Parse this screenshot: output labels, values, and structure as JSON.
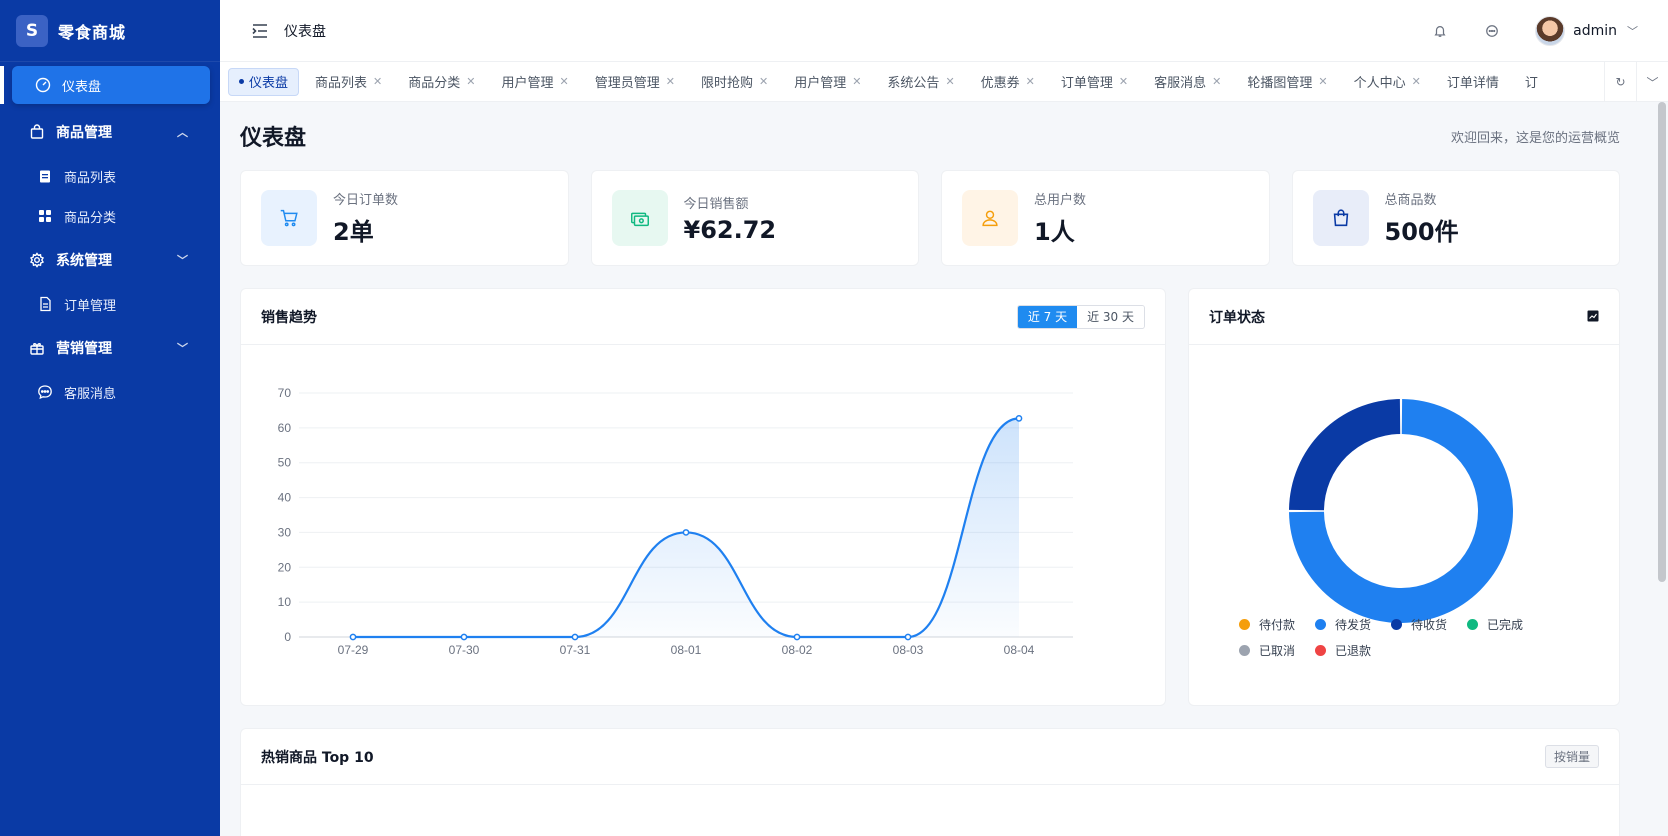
{
  "app": {
    "logo_letter": "S",
    "name": "零食商城"
  },
  "sidebar": {
    "items": [
      {
        "label": "仪表盘",
        "icon": "dashboard-icon",
        "type": "item",
        "active": true
      },
      {
        "label": "商品管理",
        "icon": "bag-icon",
        "type": "group",
        "expanded": true
      },
      {
        "label": "商品列表",
        "icon": "clipboard-icon",
        "type": "sub"
      },
      {
        "label": "商品分类",
        "icon": "grid-icon",
        "type": "sub"
      },
      {
        "label": "系统管理",
        "icon": "gear-icon",
        "type": "group",
        "expanded": false
      },
      {
        "label": "订单管理",
        "icon": "document-icon",
        "type": "sub"
      },
      {
        "label": "营销管理",
        "icon": "gift-icon",
        "type": "group",
        "expanded": false
      },
      {
        "label": "客服消息",
        "icon": "chat-icon",
        "type": "sub"
      }
    ]
  },
  "header": {
    "title": "仪表盘",
    "user": "admin"
  },
  "tabs": [
    "仪表盘",
    "商品列表",
    "商品分类",
    "用户管理",
    "管理员管理",
    "限时抢购",
    "用户管理",
    "系统公告",
    "优惠券",
    "订单管理",
    "客服消息",
    "轮播图管理",
    "个人中心",
    "订单详情",
    "订"
  ],
  "page": {
    "title": "仪表盘",
    "subtitle": "欢迎回来，这是您的运营概览"
  },
  "stats": [
    {
      "label": "今日订单数",
      "value": "2单",
      "icon": "cart-icon",
      "bg": "#e8f2fe",
      "color": "#1f8bf0"
    },
    {
      "label": "今日销售额",
      "value": "¥62.72",
      "icon": "money-icon",
      "bg": "#e7f8f1",
      "color": "#10b981"
    },
    {
      "label": "总用户数",
      "value": "1人",
      "icon": "user-icon",
      "bg": "#fff4e6",
      "color": "#f59e0b"
    },
    {
      "label": "总商品数",
      "value": "500件",
      "icon": "shopping-bag-icon",
      "bg": "#e8edf9",
      "color": "#0a3aa5"
    }
  ],
  "sales": {
    "title": "销售趋势",
    "range_7": "近 7 天",
    "range_30": "近 30 天"
  },
  "status": {
    "title": "订单状态"
  },
  "hot": {
    "title": "热销商品 Top 10",
    "sort_label": "按销量"
  },
  "colors": {
    "primary": "#1f8bf0",
    "sidebar": "#0a3aa5"
  },
  "chart_data": [
    {
      "type": "line",
      "x": [
        "07-29",
        "07-30",
        "07-31",
        "08-01",
        "08-02",
        "08-03",
        "08-04"
      ],
      "series": [
        {
          "values": [
            0,
            0,
            0,
            30,
            0,
            0,
            62.72
          ]
        }
      ],
      "ylim": [
        0,
        70
      ],
      "yticks": [
        0,
        10,
        20,
        30,
        40,
        50,
        60,
        70
      ],
      "grid": true,
      "smooth": true,
      "area": true
    },
    {
      "type": "pie",
      "donut": true,
      "categories": [
        "待付款",
        "待发货",
        "待收货",
        "已完成",
        "已取消",
        "已退款"
      ],
      "values": [
        0,
        3,
        1,
        0,
        0,
        0
      ],
      "colors": [
        "#f59e0b",
        "#1f80f0",
        "#0a3aa5",
        "#10b981",
        "#9ca3af",
        "#ef4444"
      ],
      "legend": "bottom"
    }
  ]
}
